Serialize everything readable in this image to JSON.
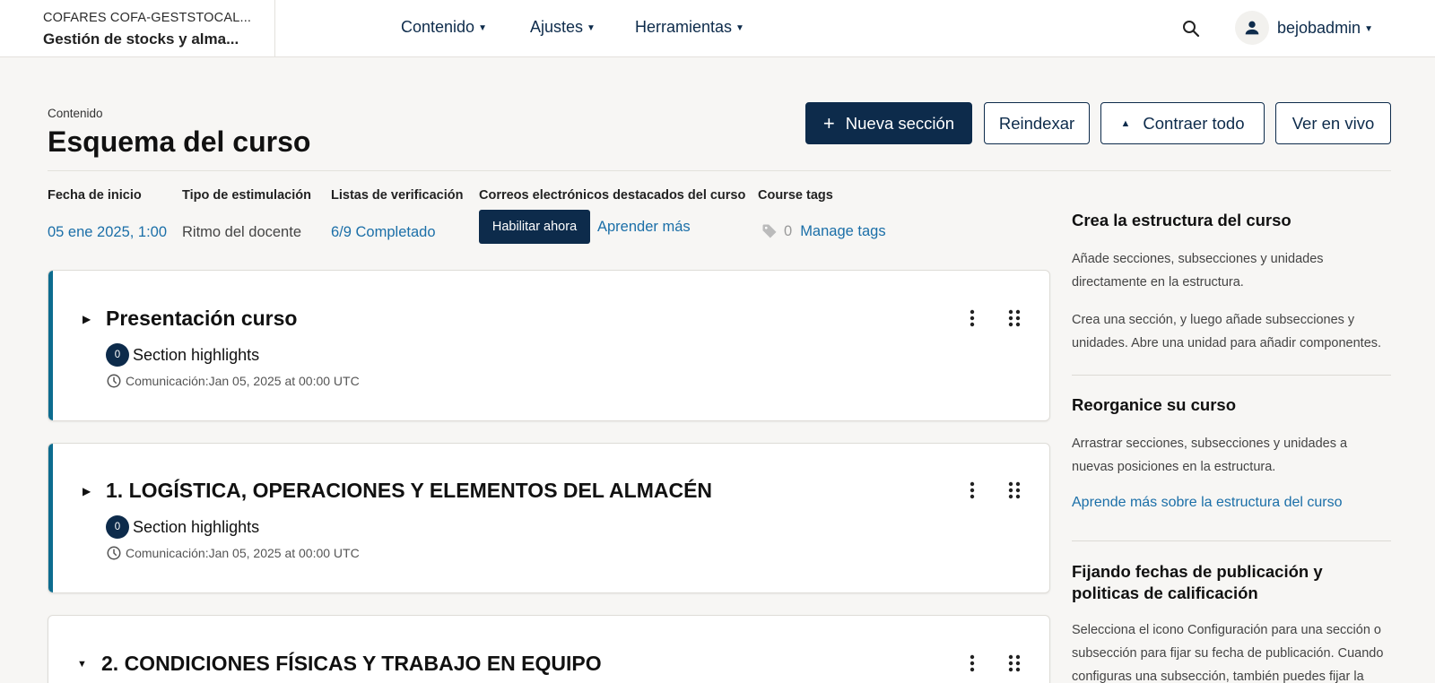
{
  "header": {
    "org": "COFARES COFA-GESTSTOCAL...",
    "course_name": "Gestión de stocks y alma...",
    "nav": [
      {
        "label": "Contenido"
      },
      {
        "label": "Ajustes"
      },
      {
        "label": "Herramientas"
      }
    ],
    "user": "bejobadmin"
  },
  "page": {
    "breadcrumb": "Contenido",
    "title": "Esquema del curso"
  },
  "actions": {
    "new_section": "Nueva sección",
    "reindex": "Reindexar",
    "collapse_all": "Contraer todo",
    "view_live": "Ver en vivo"
  },
  "info": {
    "start_date_label": "Fecha de inicio",
    "start_date_value": "05 ene 2025, 1:00",
    "pacing_label": "Tipo de estimulación",
    "pacing_value": "Ritmo del docente",
    "checklists_label": "Listas de verificación",
    "checklists_value": "6/9 Completado",
    "emails_label": "Correos electrónicos destacados del curso",
    "emails_enable": "Habilitar ahora",
    "emails_learn": "Aprender más",
    "tags_label": "Course tags",
    "tags_count": "0",
    "tags_manage": "Manage tags"
  },
  "sections": [
    {
      "title": "Presentación curso",
      "highlights_count": "0",
      "highlights_label": "Section highlights",
      "release": "Comunicación:Jan 05, 2025 at 00:00 UTC",
      "expanded": false
    },
    {
      "title": "1. LOGÍSTICA, OPERACIONES Y ELEMENTOS DEL ALMACÉN",
      "highlights_count": "0",
      "highlights_label": "Section highlights",
      "release": "Comunicación:Jan 05, 2025 at 00:00 UTC",
      "expanded": false
    },
    {
      "title": "2. CONDICIONES FÍSICAS Y TRABAJO EN EQUIPO",
      "expanded": true
    }
  ],
  "sidebar": {
    "block1_title": "Crea la estructura del curso",
    "block1_p1": "Añade secciones, subsecciones y unidades directamente en la estructura.",
    "block1_p2": "Crea una sección, y luego añade subsecciones y unidades. Abre una unidad para añadir componentes.",
    "block2_title": "Reorganice su curso",
    "block2_p1": "Arrastrar secciones, subsecciones y unidades a nuevas posiciones en la estructura.",
    "block2_link": "Aprende más sobre la estructura del curso",
    "block3_title": "Fijando fechas de publicación y politicas de calificación",
    "block3_p1": "Selecciona el icono Configuración para una sección o subsección para fijar su fecha de publicación. Cuando configuras una subsección, también puedes fijar la"
  },
  "colors": {
    "primary": "#0d2b4b",
    "link": "#1b6fa8",
    "accent_bar": "#0d6c8f",
    "background": "#f7f6f4"
  },
  "icons": [
    "search-icon",
    "user-icon",
    "chevron-down-icon",
    "plus-icon",
    "caret-up-icon",
    "tag-icon",
    "caret-right-icon",
    "caret-down-icon",
    "kebab-menu-icon",
    "drag-handle-icon",
    "clock-icon"
  ]
}
